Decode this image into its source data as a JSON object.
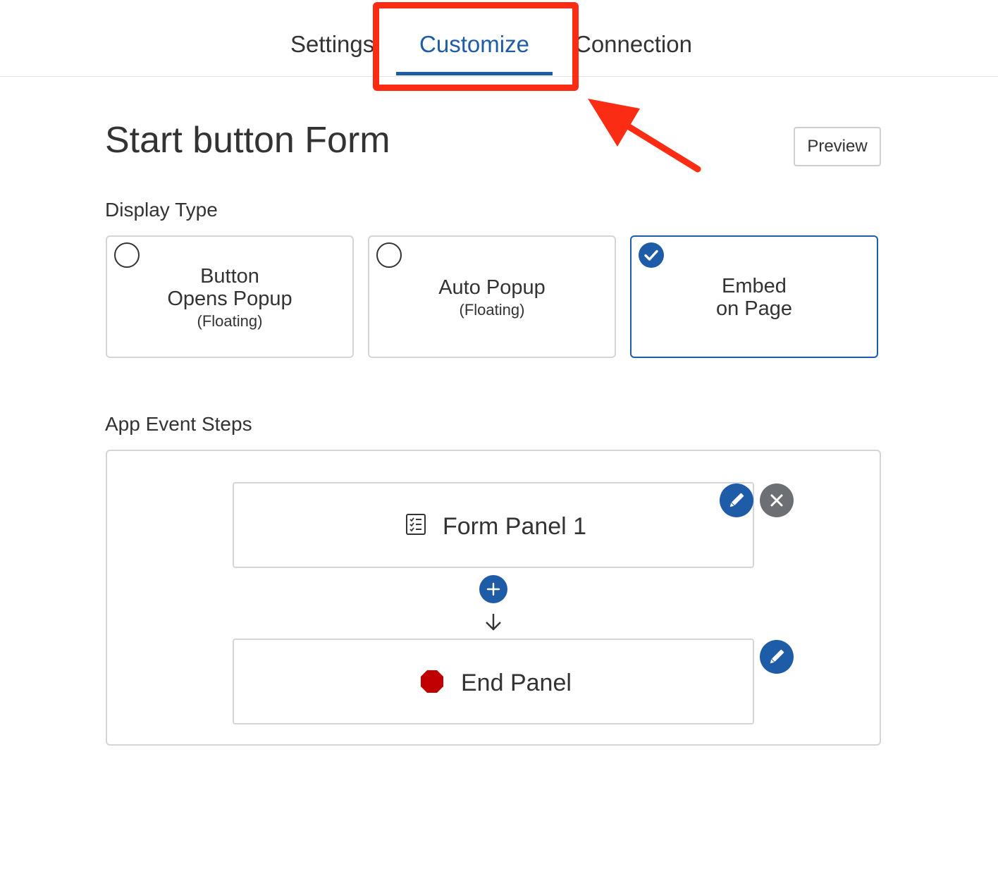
{
  "tabs": [
    {
      "label": "Settings",
      "active": false
    },
    {
      "label": "Customize",
      "active": true
    },
    {
      "label": "Connection",
      "active": false
    }
  ],
  "header": {
    "title": "Start button Form",
    "preview_label": "Preview"
  },
  "display_type": {
    "label": "Display Type",
    "options": [
      {
        "line1": "Button",
        "line2": "Opens Popup",
        "sub": "(Floating)",
        "selected": false
      },
      {
        "line1": "Auto Popup",
        "sub": "(Floating)",
        "selected": false
      },
      {
        "line1": "Embed",
        "line2": "on Page",
        "selected": true
      }
    ]
  },
  "app_event_steps": {
    "label": "App Event Steps",
    "steps": [
      {
        "label": "Form Panel 1",
        "icon": "form-list-icon"
      },
      {
        "label": "End Panel",
        "icon": "stop-octagon-icon"
      }
    ]
  },
  "colors": {
    "accent": "#1f5ca8",
    "annotation": "#fa2d14",
    "stop": "#c00000",
    "delete_button": "#6c6f73"
  }
}
